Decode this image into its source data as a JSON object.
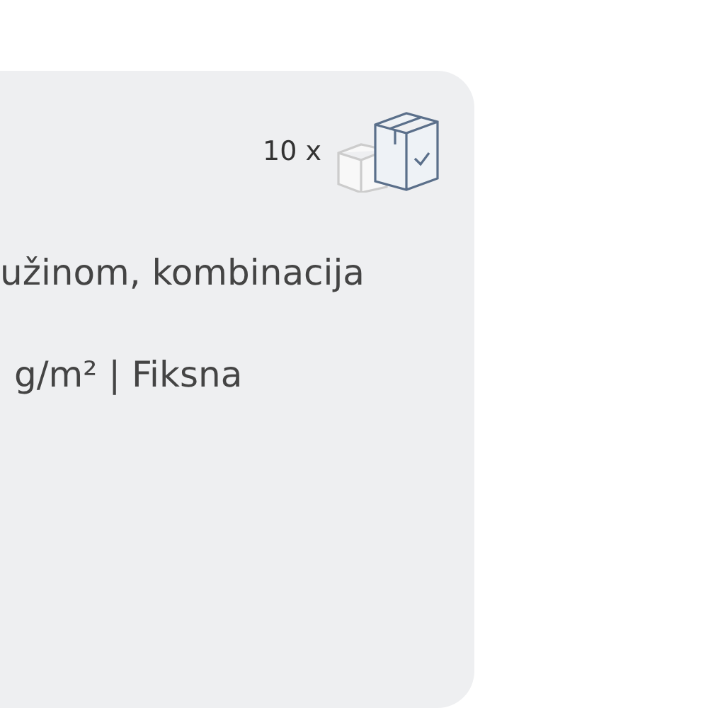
{
  "card": {
    "quantity": "10 x",
    "lines": [
      "užinom, kombinacija",
      "g/m² | Fiksna"
    ]
  }
}
